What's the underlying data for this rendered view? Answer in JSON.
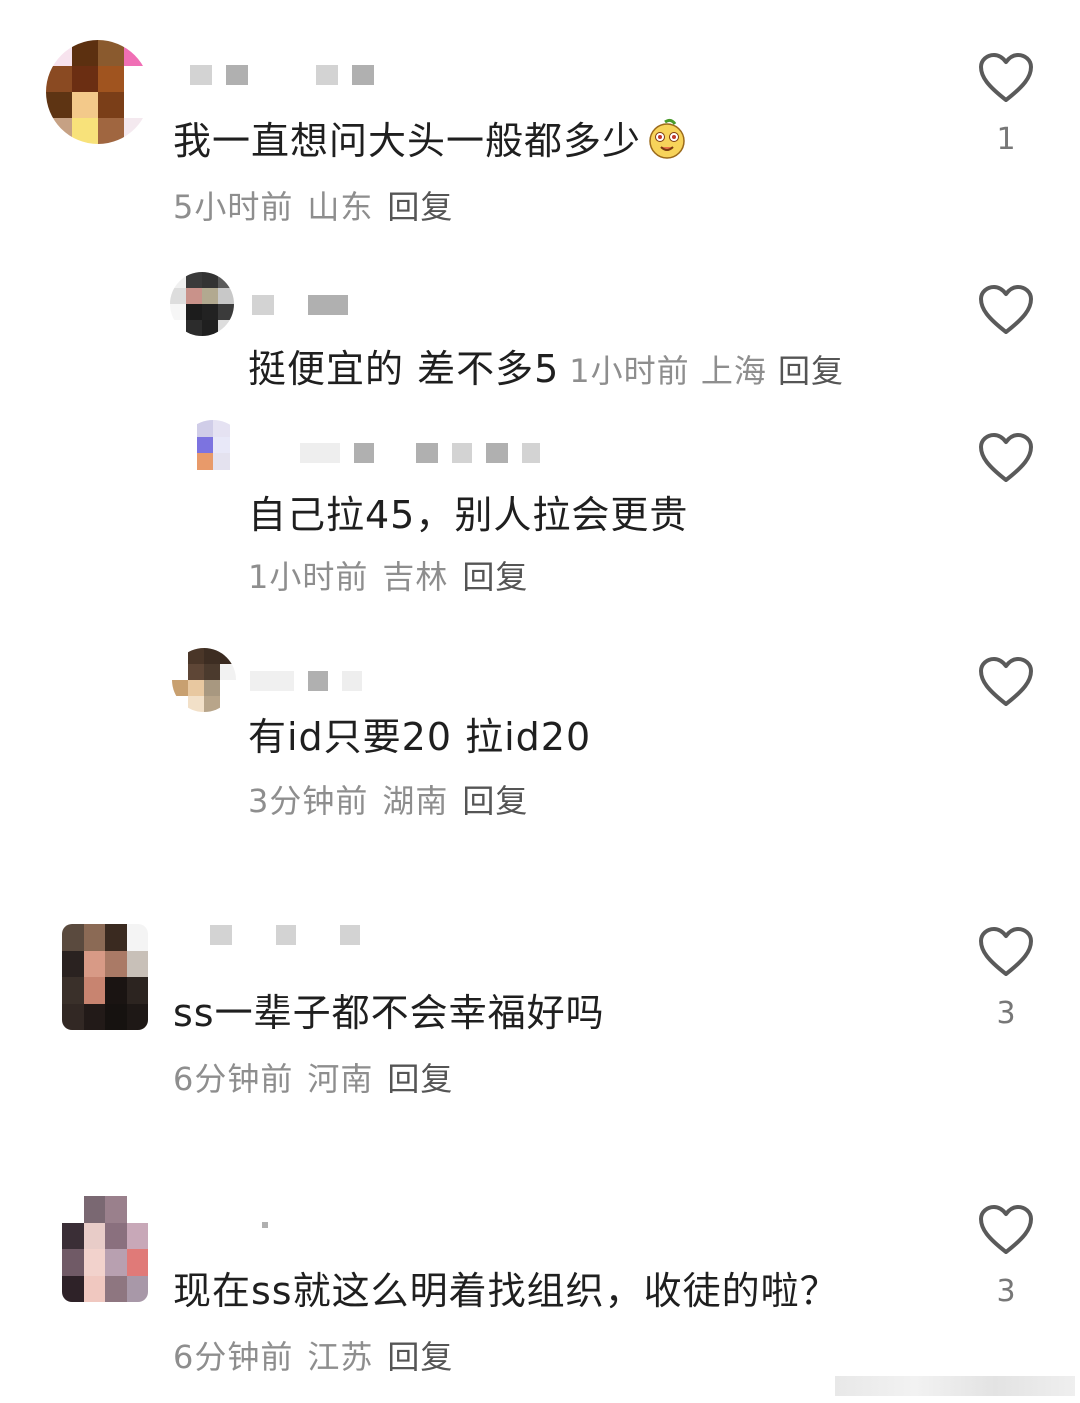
{
  "comments": [
    {
      "text": "我一直想问大头一般都多少",
      "emoji": "smiling-face-emoji",
      "time": "5小时前",
      "location": "山东",
      "reply_label": "回复",
      "likes": "1"
    },
    {
      "text": "挺便宜的 差不多5",
      "time": "1小时前",
      "location": "上海",
      "reply_label": "回复",
      "likes": ""
    },
    {
      "text": "自己拉45，别人拉会更贵",
      "time": "1小时前",
      "location": "吉林",
      "reply_label": "回复",
      "likes": ""
    },
    {
      "text": "有id只要20 拉id20",
      "time": "3分钟前",
      "location": "湖南",
      "reply_label": "回复",
      "likes": ""
    },
    {
      "text": "ss一辈子都不会幸福好吗",
      "time": "6分钟前",
      "location": "河南",
      "reply_label": "回复",
      "likes": "3"
    },
    {
      "text": "现在ss就这么明着找组织，收徒的啦？",
      "time": "6分钟前",
      "location": "江苏",
      "reply_label": "回复",
      "likes": "3"
    }
  ],
  "icons": {
    "like": "heart-outline-icon"
  },
  "colors": {
    "meta": "#8e8e8e",
    "text": "#1f1f1f",
    "icon": "#5a5a5a"
  }
}
